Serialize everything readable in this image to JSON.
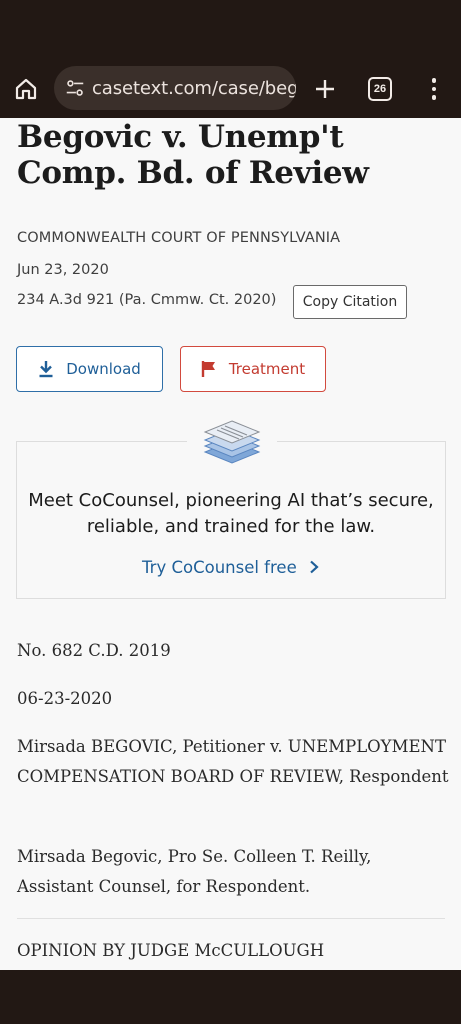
{
  "browser": {
    "url": "casetext.com/case/begc",
    "tab_count": "26"
  },
  "case": {
    "title": "Begovic v. Unemp't Comp. Bd. of Review",
    "court": "COMMONWEALTH COURT OF PENNSYLVANIA",
    "date": "Jun 23, 2020",
    "citation": "234 A.3d 921 (Pa. Cmmw. Ct. 2020)",
    "copy_citation_label": "Copy Citation",
    "download_label": "Download",
    "treatment_label": "Treatment"
  },
  "promo": {
    "text": "Meet CoCounsel, pioneering AI that’s secure, reliable, and trained for the law.",
    "link_label": "Try CoCounsel free"
  },
  "body": {
    "docket": "No. 682 C.D. 2019",
    "date": "06-23-2020",
    "parties": "Mirsada BEGOVIC, Petitioner v. UNEMPLOYMENT COMPENSATION BOARD OF REVIEW, Respondent",
    "counsel": "Mirsada Begovic, Pro Se. Colleen T. Reilly, Assistant Counsel, for Respondent.",
    "opinion_by": "OPINION BY JUDGE McCULLOUGH"
  },
  "colors": {
    "chrome_bg": "#221814",
    "link_blue": "#1f5f98",
    "treatment_red": "#c33b30",
    "page_bg": "#f8f8f8"
  },
  "icons": [
    "home-icon",
    "site-settings-icon",
    "plus-icon",
    "tab-switcher-icon",
    "more-vert-icon",
    "download-icon",
    "flag-icon",
    "document-stack-icon",
    "chevron-right-icon"
  ]
}
